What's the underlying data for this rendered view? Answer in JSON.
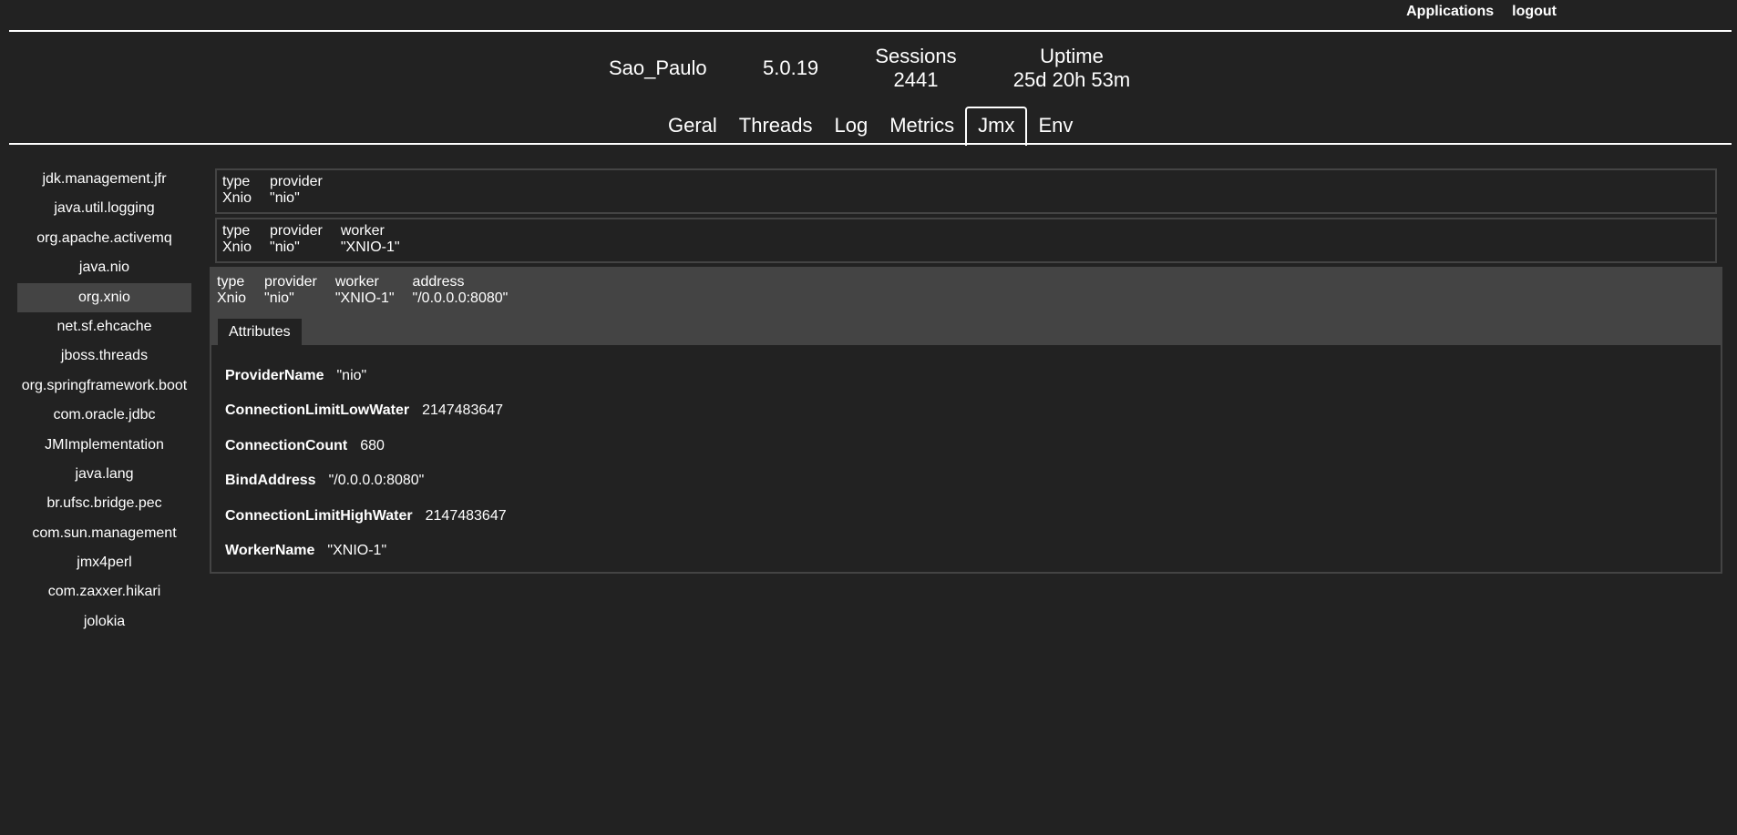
{
  "topnav": {
    "applications": "Applications",
    "logout": "logout"
  },
  "header": {
    "location": "Sao_Paulo",
    "version": "5.0.19",
    "sessions_label": "Sessions",
    "sessions_value": "2441",
    "uptime_label": "Uptime",
    "uptime_value": "25d 20h 53m"
  },
  "tabs": {
    "geral": "Geral",
    "threads": "Threads",
    "log": "Log",
    "metrics": "Metrics",
    "jmx": "Jmx",
    "env": "Env",
    "active": "Jmx"
  },
  "sidebar": {
    "items": [
      "jdk.management.jfr",
      "java.util.logging",
      "org.apache.activemq",
      "java.nio",
      "org.xnio",
      "net.sf.ehcache",
      "jboss.threads",
      "org.springframework.boot",
      "com.oracle.jdbc",
      "JMImplementation",
      "java.lang",
      "br.ufsc.bridge.pec",
      "com.sun.management",
      "jmx4perl",
      "com.zaxxer.hikari",
      "jolokia"
    ],
    "active": "org.xnio"
  },
  "mbeans": [
    {
      "keys": [
        "type",
        "provider"
      ],
      "values": [
        "Xnio",
        "\"nio\""
      ]
    },
    {
      "keys": [
        "type",
        "provider",
        "worker"
      ],
      "values": [
        "Xnio",
        "\"nio\"",
        "\"XNIO-1\""
      ]
    },
    {
      "keys": [
        "type",
        "provider",
        "worker",
        "address"
      ],
      "values": [
        "Xnio",
        "\"nio\"",
        "\"XNIO-1\"",
        "\"/0.0.0.0:8080\""
      ],
      "expanded": true,
      "tab_label": "Attributes",
      "attributes": [
        {
          "name": "ProviderName",
          "value": "\"nio\""
        },
        {
          "name": "ConnectionLimitLowWater",
          "value": "2147483647"
        },
        {
          "name": "ConnectionCount",
          "value": "680"
        },
        {
          "name": "BindAddress",
          "value": "\"/0.0.0.0:8080\""
        },
        {
          "name": "ConnectionLimitHighWater",
          "value": "2147483647"
        },
        {
          "name": "WorkerName",
          "value": "\"XNIO-1\""
        }
      ]
    }
  ],
  "colors": {
    "background": "#222222",
    "panel": "#444444",
    "text": "#ffffff"
  }
}
